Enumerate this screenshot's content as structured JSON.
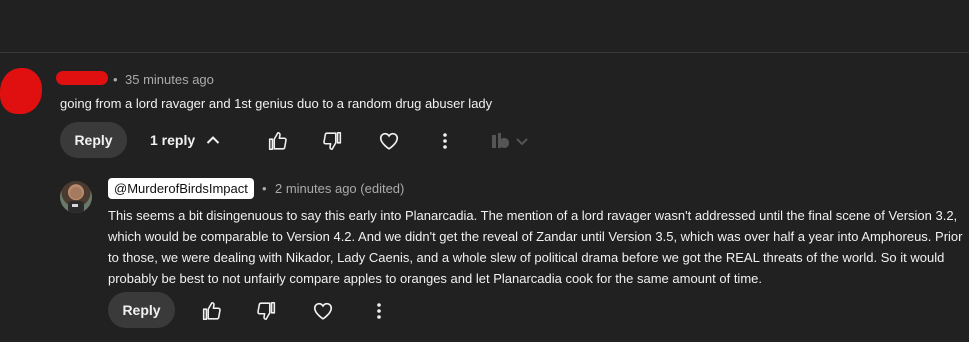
{
  "comment1": {
    "timestamp": "35 minutes ago",
    "text": "going from a lord ravager and 1st genius duo to a random drug abuser lady",
    "reply_label": "Reply",
    "replies_label": "1 reply"
  },
  "comment2": {
    "handle": "@MurderofBirdsImpact",
    "timestamp": "2 minutes ago (edited)",
    "lines": [
      "This seems a bit disingenuous to say this early into Planarcadia. The mention of a lord ravager wasn't addressed until the final scene of Version 3.2,",
      "which would be comparable to Version 4.2. And we didn't get the reveal of Zandar until Version 3.5, which was over half a year into Amphoreus. Prior",
      "to those, we were dealing with Nikador, Lady Caenis, and a whole slew of political drama before we got the REAL threats of the world. So it would",
      "probably be best to not unfairly compare apples to oranges and let Planarcadia cook for the same amount of time."
    ],
    "reply_label": "Reply"
  },
  "separator": "•",
  "icons": [
    "like-icon",
    "dislike-icon",
    "heart-icon",
    "more-icon",
    "tubebuddy-icon",
    "chevron-down-icon",
    "chevron-up-icon"
  ]
}
